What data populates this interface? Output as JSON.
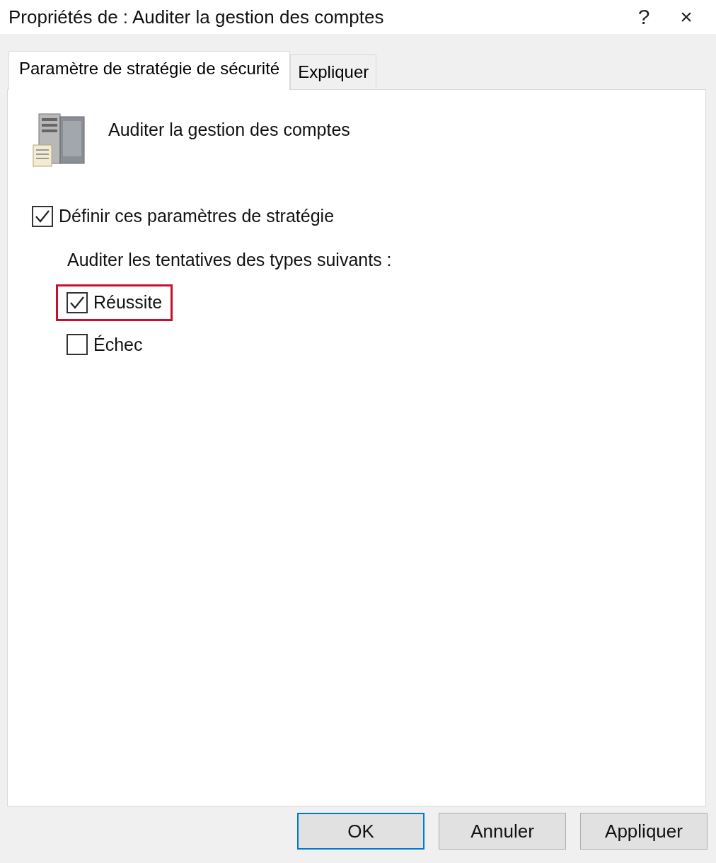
{
  "window": {
    "title": "Propriétés de : Auditer la gestion des comptes",
    "help": "?",
    "close": "×"
  },
  "tabs": [
    {
      "label": "Paramètre de stratégie de sécurité",
      "selected": true
    },
    {
      "label": "Expliquer",
      "selected": false
    }
  ],
  "policy": {
    "name": "Auditer la gestion des comptes"
  },
  "define": {
    "label": "Définir ces paramètres de stratégie",
    "checked": true
  },
  "audit_label": "Auditer les tentatives des types suivants :",
  "options": [
    {
      "label": "Réussite",
      "checked": true,
      "highlighted": true
    },
    {
      "label": "Échec",
      "checked": false,
      "highlighted": false
    }
  ],
  "buttons": [
    {
      "label": "OK",
      "default": true
    },
    {
      "label": "Annuler",
      "default": false
    },
    {
      "label": "Appliquer",
      "default": false
    }
  ]
}
